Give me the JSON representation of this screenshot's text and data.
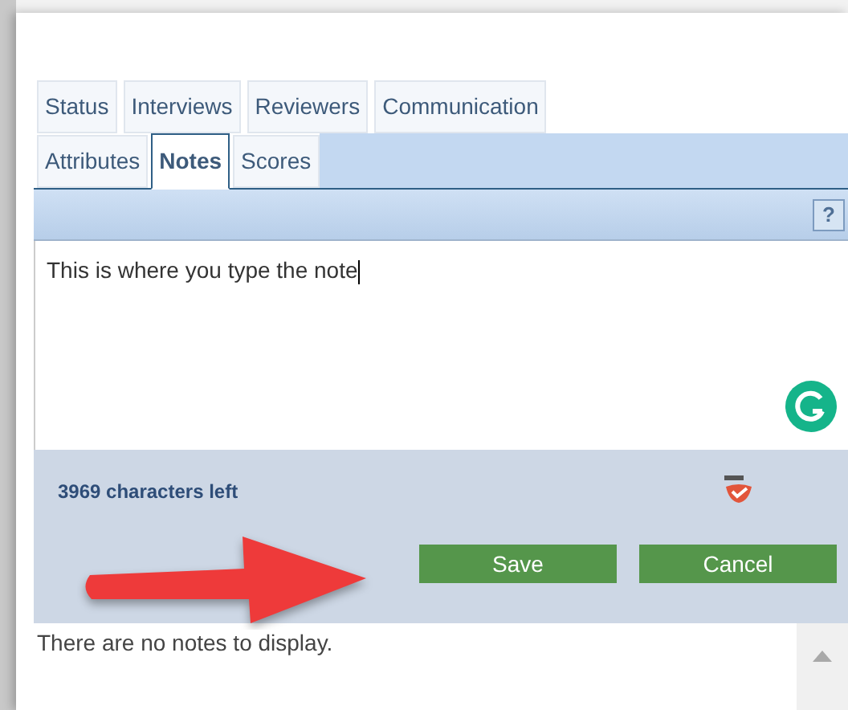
{
  "tab_rows": [
    [
      {
        "label": "Status",
        "selected": false
      },
      {
        "label": "Interviews",
        "selected": false
      },
      {
        "label": "Reviewers",
        "selected": false
      },
      {
        "label": "Communication",
        "selected": false
      }
    ],
    [
      {
        "label": "Attributes",
        "selected": false
      },
      {
        "label": "Notes",
        "selected": true
      },
      {
        "label": "Scores",
        "selected": false
      }
    ]
  ],
  "help_button": "?",
  "note_field": {
    "value": "This is where you type the note"
  },
  "characters_left": "3969 characters left",
  "buttons": [
    "Save",
    "Cancel"
  ],
  "notes_list": {
    "empty_message": "There are no notes to display."
  }
}
